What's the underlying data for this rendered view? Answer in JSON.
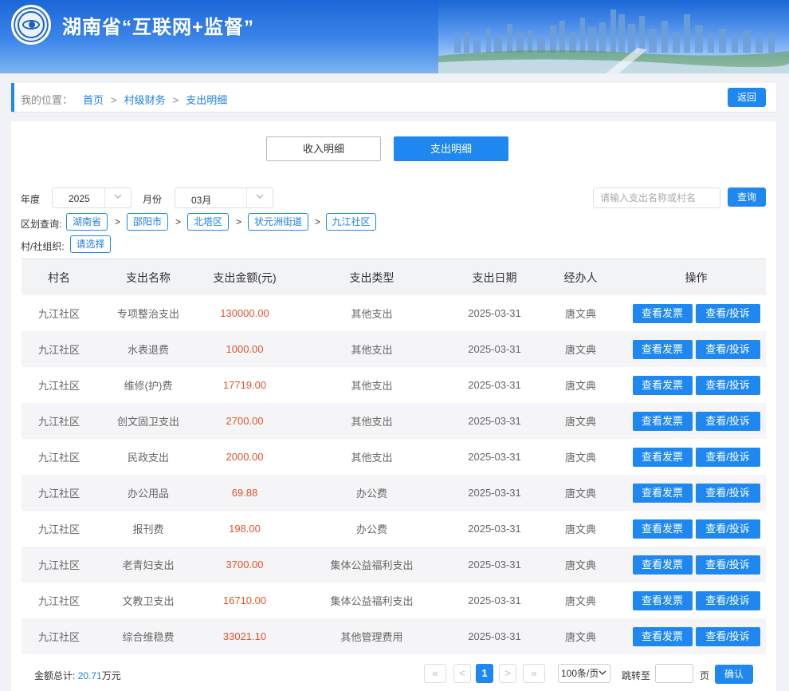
{
  "header": {
    "title": "湖南省“互联网+监督”"
  },
  "breadcrumb": {
    "label": "我的位置：",
    "items": [
      "首页",
      "村级财务",
      "支出明细"
    ],
    "sep": ">",
    "back_label": "返回"
  },
  "tabs": {
    "income": "收入明细",
    "expense": "支出明细",
    "active": "expense"
  },
  "filters": {
    "year_label": "年度",
    "year_value": "2025",
    "month_label": "月份",
    "month_value": "03月",
    "search_placeholder": "请输入支出名称或村名",
    "query_label": "查询",
    "region_label": "区划查询:",
    "regions": [
      "湖南省",
      "邵阳市",
      "北塔区",
      "状元洲街道",
      "九江社区"
    ],
    "arrow": ">",
    "org_label": "村/社组织:",
    "org_select": "请选择"
  },
  "table": {
    "columns": [
      "村名",
      "支出名称",
      "支出金额(元)",
      "支出类型",
      "支出日期",
      "经办人",
      "操作"
    ],
    "rows": [
      [
        "九江社区",
        "专项整治支出",
        "130000.00",
        "其他支出",
        "2025-03-31",
        "唐文典"
      ],
      [
        "九江社区",
        "水表退费",
        "1000.00",
        "其他支出",
        "2025-03-31",
        "唐文典"
      ],
      [
        "九江社区",
        "维修(护)费",
        "17719.00",
        "其他支出",
        "2025-03-31",
        "唐文典"
      ],
      [
        "九江社区",
        "创文固卫支出",
        "2700.00",
        "其他支出",
        "2025-03-31",
        "唐文典"
      ],
      [
        "九江社区",
        "民政支出",
        "2000.00",
        "其他支出",
        "2025-03-31",
        "唐文典"
      ],
      [
        "九江社区",
        "办公用品",
        "69.88",
        "办公费",
        "2025-03-31",
        "唐文典"
      ],
      [
        "九江社区",
        "报刊费",
        "198.00",
        "办公费",
        "2025-03-31",
        "唐文典"
      ],
      [
        "九江社区",
        "老青妇支出",
        "3700.00",
        "集体公益福利支出",
        "2025-03-31",
        "唐文典"
      ],
      [
        "九江社区",
        "文教卫支出",
        "16710.00",
        "集体公益福利支出",
        "2025-03-31",
        "唐文典"
      ],
      [
        "九江社区",
        "综合维稳费",
        "33021.10",
        "其他管理费用",
        "2025-03-31",
        "唐文典"
      ]
    ],
    "op_invoice": "查看发票",
    "op_view": "查看/投诉"
  },
  "footer": {
    "total_label": "金额总计:",
    "total_value": "20.71",
    "total_unit": "万元",
    "page_first": "«",
    "page_prev": "<",
    "page_current": "1",
    "page_next": ">",
    "page_last": "»",
    "page_size": "100条/页",
    "jump_label": "跳转至",
    "page_unit": "页",
    "confirm_label": "确认"
  },
  "colors": {
    "primary": "#1e88f0",
    "amount": "#e0552e",
    "banner": "#1b67d6"
  }
}
